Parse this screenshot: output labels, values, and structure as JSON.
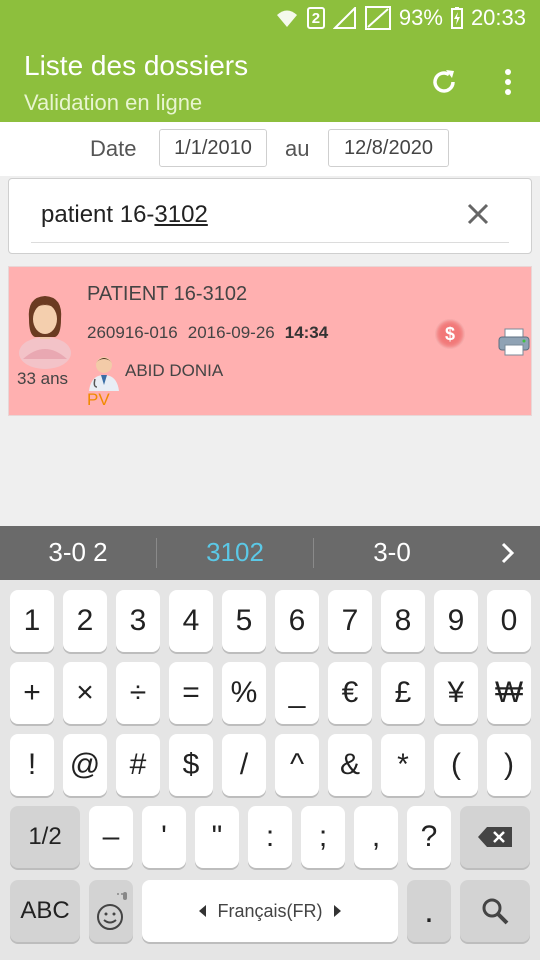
{
  "status_bar": {
    "sim_badge": "2",
    "battery": "93%",
    "time": "20:33"
  },
  "app_bar": {
    "title": "Liste des dossiers",
    "subtitle": "Validation en ligne",
    "refresh_icon": "refresh-icon",
    "menu_icon": "more-vert-icon"
  },
  "filter": {
    "date_label": "Date",
    "from": "1/1/2010",
    "to_label": "au",
    "to": "12/8/2020"
  },
  "search": {
    "prefix": "patient 16-",
    "underlined": "3102",
    "clear_icon": "close-icon"
  },
  "record": {
    "name": "PATIENT 16-3102",
    "id": "260916-016",
    "date": "2016-09-26",
    "time": "14:34",
    "age": "33 ans",
    "doctor": "ABID DONIA",
    "tag": "PV",
    "dollar": "$",
    "colors": {
      "background": "#ffb0b0",
      "tag": "#f08a00"
    }
  },
  "keyboard": {
    "suggestions": [
      "3-0 2",
      "3102",
      "3-0"
    ],
    "row1": [
      "1",
      "2",
      "3",
      "4",
      "5",
      "6",
      "7",
      "8",
      "9",
      "0"
    ],
    "row2": [
      "+",
      "×",
      "÷",
      "=",
      "%",
      "_",
      "€",
      "£",
      "¥",
      "₩"
    ],
    "row3": [
      "!",
      "@",
      "#",
      "$",
      "/",
      "^",
      "&",
      "*",
      "(",
      ")"
    ],
    "row4": [
      "1/2",
      "–",
      "'",
      "\"",
      ":",
      ";",
      ",",
      "?"
    ],
    "abc": "ABC",
    "space": "Français(FR)",
    "period": "."
  },
  "colors": {
    "accent": "#8dbf3d",
    "suggest_highlight": "#5bc8e6"
  }
}
